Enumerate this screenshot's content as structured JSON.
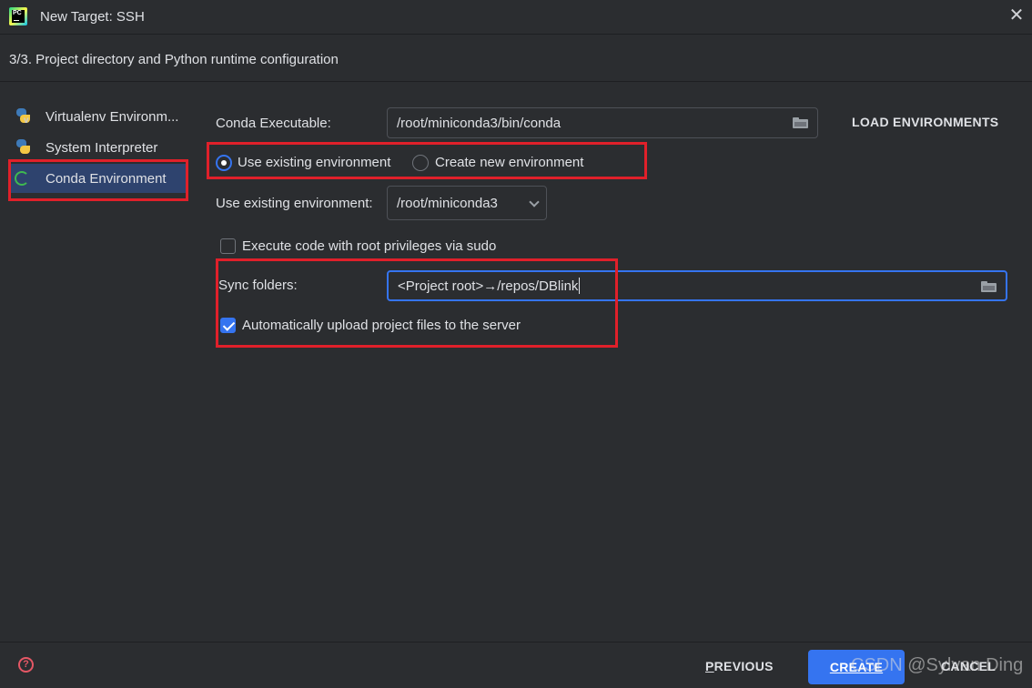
{
  "window": {
    "title": "New Target: SSH",
    "logo_text": "PC"
  },
  "step": {
    "title": "3/3. Project directory and Python runtime configuration"
  },
  "sidebar": {
    "items": [
      {
        "label": "Virtualenv Environm...",
        "icon": "python-venv-icon"
      },
      {
        "label": "System Interpreter",
        "icon": "python-icon"
      },
      {
        "label": "Conda Environment",
        "icon": "conda-icon",
        "selected": true
      }
    ]
  },
  "form": {
    "conda_executable_label": "Conda Executable:",
    "conda_executable_value": "/root/miniconda3/bin/conda",
    "load_environments_label": "LOAD ENVIRONMENTS",
    "radio_existing_label": "Use existing environment",
    "radio_new_label": "Create new environment",
    "existing_env_label": "Use existing environment:",
    "existing_env_value": "/root/miniconda3",
    "sudo_label": "Execute code with root privileges via sudo",
    "sudo_checked": false,
    "sync_folders_label": "Sync folders:",
    "sync_folders_value": "<Project root>→/repos/DBlink",
    "auto_upload_label": "Automatically upload project files to the server",
    "auto_upload_checked": true
  },
  "footer": {
    "previous_first": "P",
    "previous_rest": "REVIOUS",
    "create_label": "CREATE",
    "cancel_label": "CANCEL",
    "help_symbol": "?"
  },
  "watermark": "CSDN @Sylvan Ding",
  "colors": {
    "background": "#2b2d30",
    "accent": "#3574f0",
    "selection": "#2e436e",
    "annotation_red": "#e0202a"
  }
}
